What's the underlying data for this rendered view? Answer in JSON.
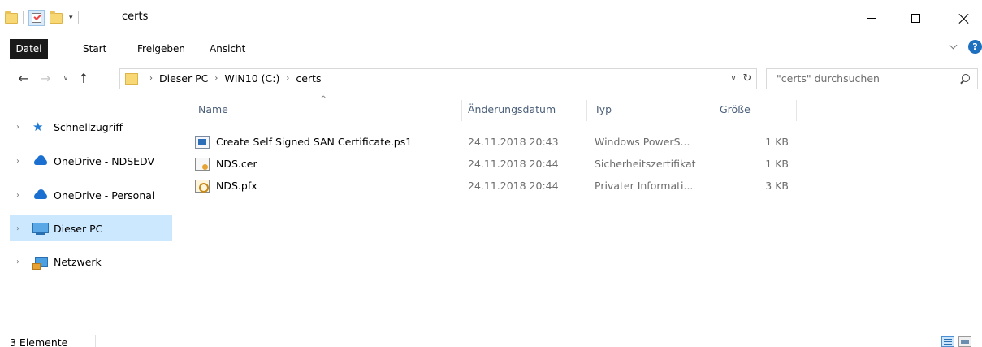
{
  "window": {
    "title": "certs",
    "quick_access_dropdown": "▾"
  },
  "ribbon": {
    "tabs": [
      {
        "label": "Datei"
      },
      {
        "label": "Start"
      },
      {
        "label": "Freigeben"
      },
      {
        "label": "Ansicht"
      }
    ],
    "help_label": "?"
  },
  "address": {
    "breadcrumbs": [
      "Dieser PC",
      "WIN10 (C:)",
      "certs"
    ],
    "separator": "›",
    "dropdown": "∨",
    "refresh": "↻"
  },
  "nav_buttons": {
    "back": "←",
    "forward": "→",
    "recent": "∨",
    "up": "↑"
  },
  "search": {
    "placeholder": "\"certs\" durchsuchen"
  },
  "navpane": {
    "items": [
      {
        "label": "Schnellzugriff",
        "icon": "star-icon"
      },
      {
        "label": "OneDrive - NDSEDV",
        "icon": "onedrive-icon"
      },
      {
        "label": "OneDrive - Personal",
        "icon": "onedrive-icon"
      },
      {
        "label": "Dieser PC",
        "icon": "computer-icon",
        "selected": true
      },
      {
        "label": "Netzwerk",
        "icon": "network-icon"
      }
    ],
    "chevron": "›"
  },
  "filelist": {
    "columns": {
      "name": "Name",
      "date": "Änderungsdatum",
      "type": "Typ",
      "size": "Größe"
    },
    "sort_indicator": "^",
    "rows": [
      {
        "name": "Create Self Signed SAN Certificate.ps1",
        "date": "24.11.2018 20:43",
        "type": "Windows PowerS...",
        "size": "1 KB",
        "icon": "powershell-file-icon"
      },
      {
        "name": "NDS.cer",
        "date": "24.11.2018 20:44",
        "type": "Sicherheitszertifikat",
        "size": "1 KB",
        "icon": "certificate-file-icon"
      },
      {
        "name": "NDS.pfx",
        "date": "24.11.2018 20:44",
        "type": "Privater Informati...",
        "size": "3 KB",
        "icon": "pfx-file-icon"
      }
    ]
  },
  "status": {
    "count": "3 Elemente"
  }
}
